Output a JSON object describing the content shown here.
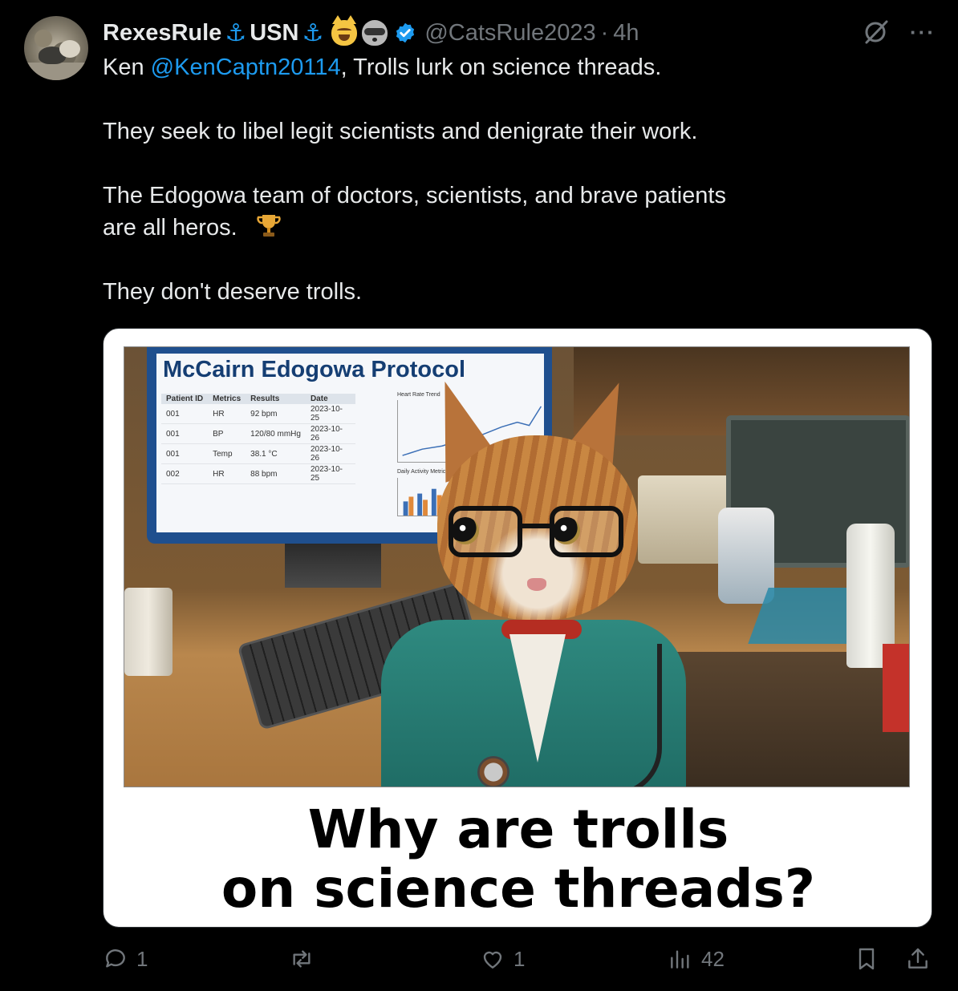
{
  "author": {
    "display_name": "RexesRule",
    "usn": "USN",
    "handle": "@CatsRule2023",
    "separator": "·",
    "time": "4h"
  },
  "icons": {
    "anchor": "⚓",
    "more": "···"
  },
  "post": {
    "line1_prefix": "Ken ",
    "mention": "@KenCaptn20114",
    "line1_suffix": ", Trolls lurk on science threads.",
    "para2": "They seek to libel legit scientists and denigrate their work.",
    "para3_line1": "The Edogowa team of doctors, scientists, and brave patients",
    "para3_line2": "are all heros.",
    "para4": "They don't deserve trolls."
  },
  "media": {
    "screen_title": "McCairn Edogowa Protocol",
    "table": {
      "headers": [
        "Patient ID",
        "Metrics",
        "Results",
        "Date"
      ],
      "rows": [
        [
          "001",
          "HR",
          "92 bpm",
          "2023-10-25"
        ],
        [
          "001",
          "BP",
          "120/80 mmHg",
          "2023-10-26"
        ],
        [
          "001",
          "Temp",
          "38.1 °C",
          "2023-10-26"
        ],
        [
          "002",
          "HR",
          "88 bpm",
          "2023-10-25"
        ]
      ]
    },
    "chart1_label": "Heart Rate Trend",
    "chart2_label": "Daily Activity Metrics",
    "caption_line1": "Why are trolls",
    "caption_line2": "on science threads?"
  },
  "stats": {
    "replies": "1",
    "reposts": "",
    "likes": "1",
    "views": "42"
  },
  "colors": {
    "background": "#000000",
    "text": "#e7e9ea",
    "muted": "#71767b",
    "accent": "#1d9bf0"
  }
}
